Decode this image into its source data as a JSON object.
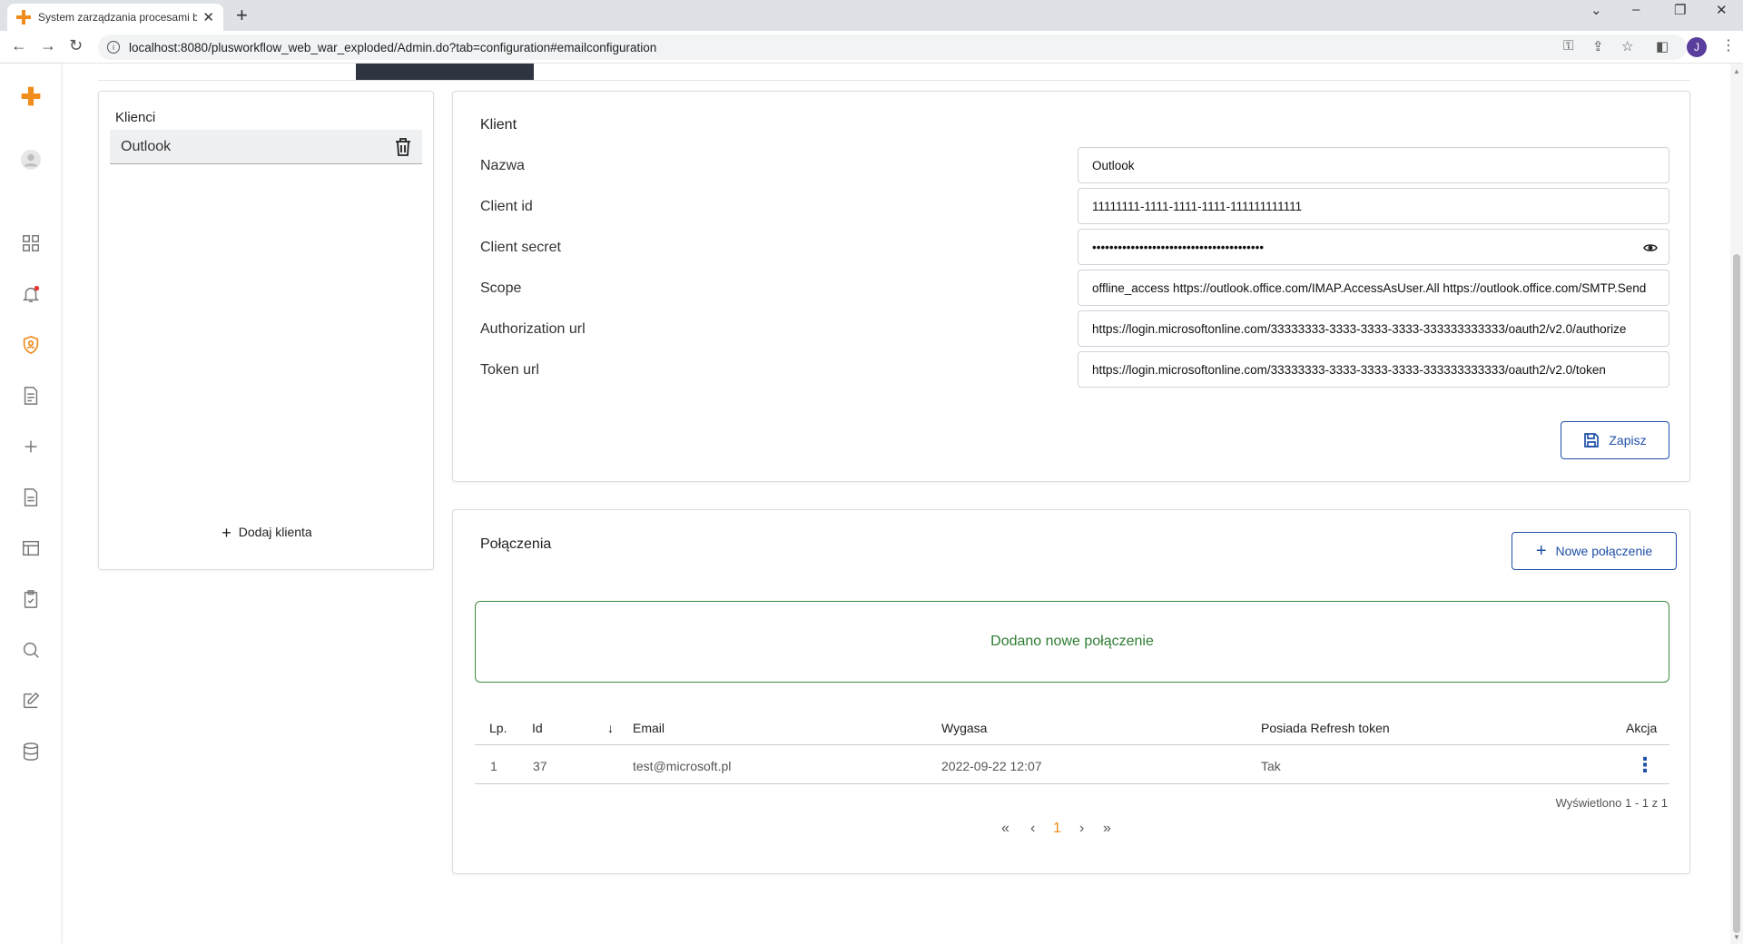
{
  "browser": {
    "tab_title": "System zarządzania procesami bi",
    "url": "localhost:8080/plusworkflow_web_war_exploded/Admin.do?tab=configuration#emailconfiguration",
    "profile_initial": "J"
  },
  "clients": {
    "title": "Klienci",
    "items": [
      {
        "name": "Outlook"
      }
    ],
    "add_label": "Dodaj klienta"
  },
  "client_form": {
    "title": "Klient",
    "fields": [
      {
        "label": "Nazwa",
        "value": "Outlook"
      },
      {
        "label": "Client id",
        "value": "11111111-1111-1111-1111-111111111111"
      },
      {
        "label": "Client secret",
        "value": "••••••••••••••••••••••••••••••••••••••••"
      },
      {
        "label": "Scope",
        "value": "offline_access https://outlook.office.com/IMAP.AccessAsUser.All https://outlook.office.com/SMTP.Send"
      },
      {
        "label": "Authorization url",
        "value": "https://login.microsoftonline.com/33333333-3333-3333-3333-333333333333/oauth2/v2.0/authorize"
      },
      {
        "label": "Token url",
        "value": "https://login.microsoftonline.com/33333333-3333-3333-3333-333333333333/oauth2/v2.0/token"
      }
    ],
    "save_label": "Zapisz"
  },
  "connections": {
    "title": "Połączenia",
    "new_label": "Nowe połączenie",
    "alert": "Dodano nowe połączenie",
    "columns": {
      "lp": "Lp.",
      "id": "Id",
      "email": "Email",
      "expires": "Wygasa",
      "refresh": "Posiada Refresh token",
      "action": "Akcja"
    },
    "rows": [
      {
        "lp": "1",
        "id": "37",
        "email": "test@microsoft.pl",
        "expires": "2022-09-22 12:07",
        "refresh": "Tak"
      }
    ],
    "summary": "Wyświetlono 1 - 1 z 1",
    "current_page": "1"
  },
  "colors": {
    "brand": "#f08c1c",
    "primary": "#1f4fa8",
    "success": "#2e7d32",
    "dark_tab": "#2e3440"
  }
}
